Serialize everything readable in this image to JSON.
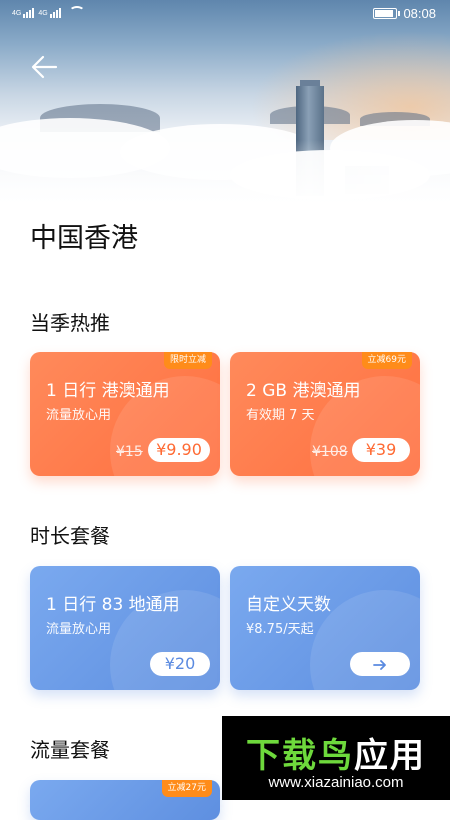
{
  "status_bar": {
    "sim1_label": "4G",
    "sim2_label": "4G",
    "time": "08:08",
    "battery_level": 0.8
  },
  "header": {
    "back_icon": "arrow-left-icon",
    "title": "中国香港"
  },
  "sections": {
    "hot": "当季热推",
    "duration": "时长套餐",
    "data": "流量套餐"
  },
  "hot_cards": [
    {
      "badge": "限时立减",
      "name": "1 日行  港澳通用",
      "desc": "流量放心用",
      "original_price": "¥15",
      "price": "¥9.90"
    },
    {
      "badge": "立减69元",
      "name": "2 GB 港澳通用",
      "desc": "有效期 7 天",
      "original_price": "¥108",
      "price": "¥39"
    }
  ],
  "duration_cards": [
    {
      "name": "1 日行  83 地通用",
      "desc": "流量放心用",
      "price": "¥20"
    },
    {
      "name": "自定义天数",
      "desc": "¥8.75/天起",
      "action_icon": "arrow-right-icon"
    }
  ],
  "data_cards": [
    {
      "badge": "立减27元"
    }
  ],
  "watermark": {
    "brand_part1": "下载鸟",
    "brand_part2": "应用",
    "url": "www.xiazainiao.com"
  },
  "colors": {
    "hot_card": "#ff7346",
    "duration_card": "#6c9ae8",
    "badge": "#ff8c1a"
  }
}
